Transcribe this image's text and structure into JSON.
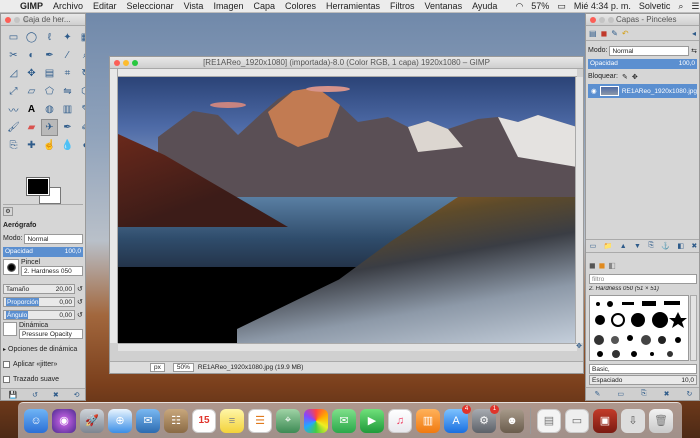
{
  "menubar": {
    "app": "GIMP",
    "items": [
      "Archivo",
      "Editar",
      "Seleccionar",
      "Vista",
      "Imagen",
      "Capa",
      "Colores",
      "Herramientas",
      "Filtros",
      "Ventanas",
      "Ayuda"
    ],
    "battery": "57%",
    "clock": "Mié 4:34 p. m.",
    "user": "Solvetic"
  },
  "toolbox": {
    "title": "Caja de her...",
    "tool_options_title": "Aerógrafo",
    "mode_label": "Modo:",
    "mode_value": "Normal",
    "opacity_label": "Opacidad",
    "opacity_value": "100,0",
    "brush_label": "Pincel",
    "brush_value": "2. Hardness 050",
    "size_label": "Tamaño",
    "size_value": "20,00",
    "ratio_label": "Proporción",
    "ratio_value": "0,00",
    "angle_label": "Ángulo",
    "angle_value": "0,00",
    "dynamics_label": "Dinámica",
    "dynamics_value": "Pressure Opacity",
    "dyn_options": "Opciones de dinámica",
    "jitter": "Aplicar «jitter»",
    "smooth": "Trazado suave"
  },
  "image_window": {
    "title": "[RE1AReo_1920x1080] (importada)-8.0 (Color RGB, 1 capa) 1920x1080 – GIMP",
    "unit": "px",
    "zoom": "50%",
    "status": "RE1AReo_1920x1080.jpg (19.9 MB)"
  },
  "layers": {
    "title": "Capas - Pinceles",
    "mode_label": "Modo:",
    "mode_value": "Normal",
    "opacity_label": "Opacidad",
    "opacity_value": "100,0",
    "lock_label": "Bloquear:",
    "layer_name": "RE1AReo_1920x1080.jpg",
    "filter_placeholder": "filtro",
    "brush_name": "2. Hardness 050 (51 × 51)",
    "preset_value": "Basic,",
    "spacing_label": "Espaciado",
    "spacing_value": "10,0"
  },
  "dock": {
    "calendar_day": "15",
    "appstore_badge": "4",
    "prefs_badge": "1"
  },
  "icons": [
    "apple-icon",
    "wifi-icon",
    "battery-icon",
    "search-icon",
    "menu-icon",
    "trash-icon"
  ]
}
